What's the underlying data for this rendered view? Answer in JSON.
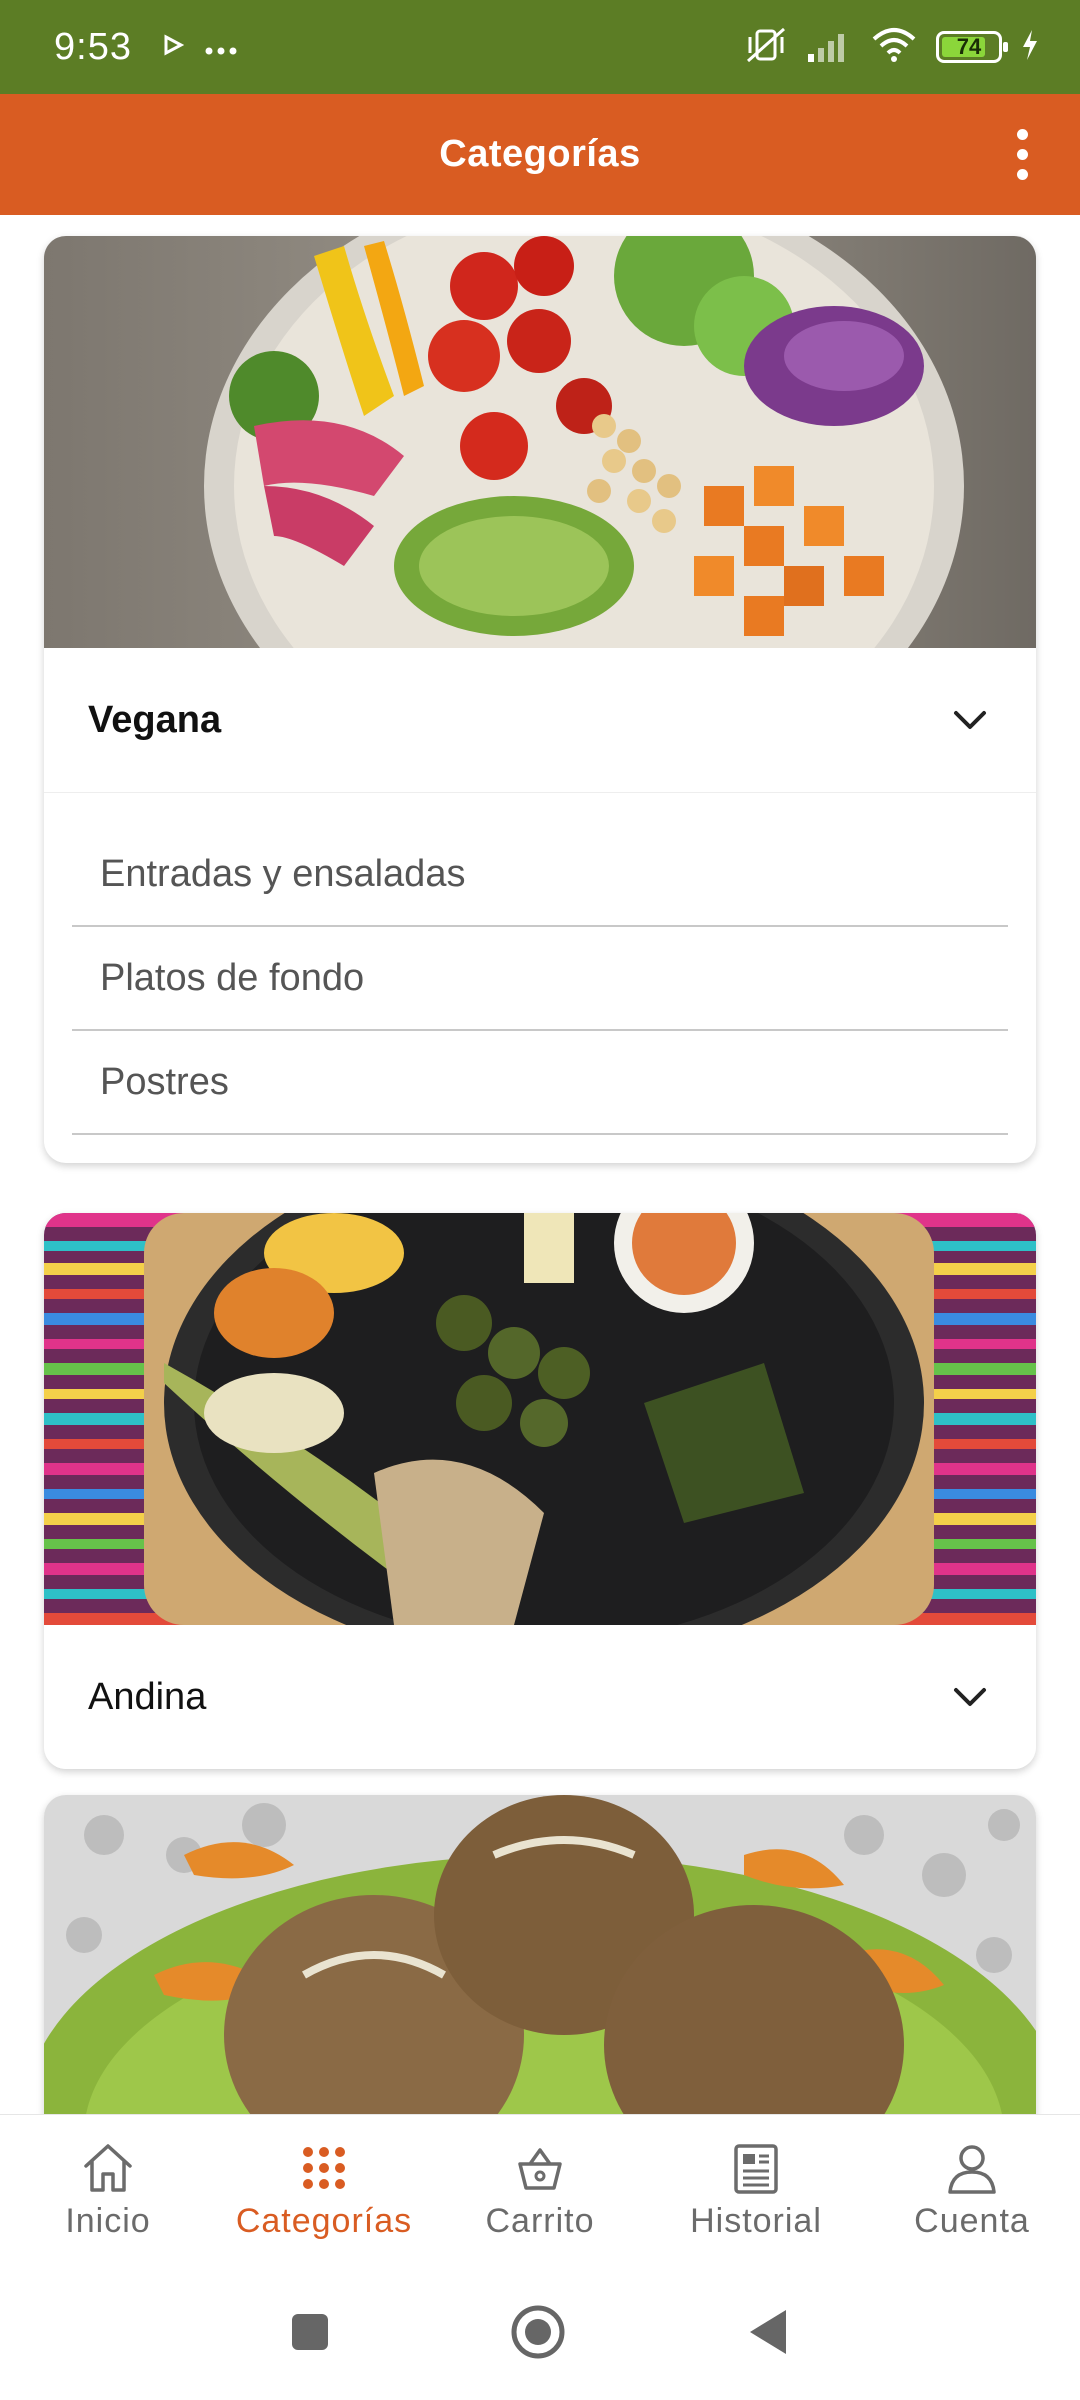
{
  "status_bar": {
    "time": "9:53",
    "battery": "74"
  },
  "app_bar": {
    "title": "Categorías"
  },
  "categories": [
    {
      "title": "Vegana",
      "expanded": true,
      "subcategories": [
        "Entradas y ensaladas",
        "Platos de fondo",
        "Postres"
      ]
    },
    {
      "title": "Andina",
      "expanded": false
    }
  ],
  "bottom_nav": {
    "items": [
      {
        "label": "Inicio",
        "icon": "home-icon"
      },
      {
        "label": "Categorías",
        "icon": "grid-dots-icon",
        "active": true
      },
      {
        "label": "Carrito",
        "icon": "basket-icon"
      },
      {
        "label": "Historial",
        "icon": "document-icon"
      },
      {
        "label": "Cuenta",
        "icon": "user-icon"
      }
    ]
  },
  "colors": {
    "status_bar": "#5c7d25",
    "app_bar": "#d95c22",
    "accent": "#d95c22"
  }
}
